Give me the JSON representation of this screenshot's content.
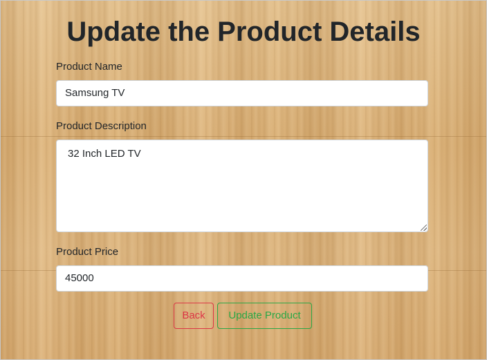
{
  "page": {
    "title": "Update the Product Details"
  },
  "form": {
    "name": {
      "label": "Product Name",
      "value": "Samsung TV"
    },
    "description": {
      "label": "Product Description",
      "value": "32 Inch LED TV"
    },
    "price": {
      "label": "Product Price",
      "value": "45000"
    }
  },
  "actions": {
    "back_label": "Back",
    "update_label": "Update Product"
  },
  "colors": {
    "back_button": "#dc3545",
    "update_button": "#28a745",
    "title_text": "#212529",
    "background": "#dcb47f"
  },
  "icons": {
    "textarea_resize": "resize-grip-icon"
  }
}
